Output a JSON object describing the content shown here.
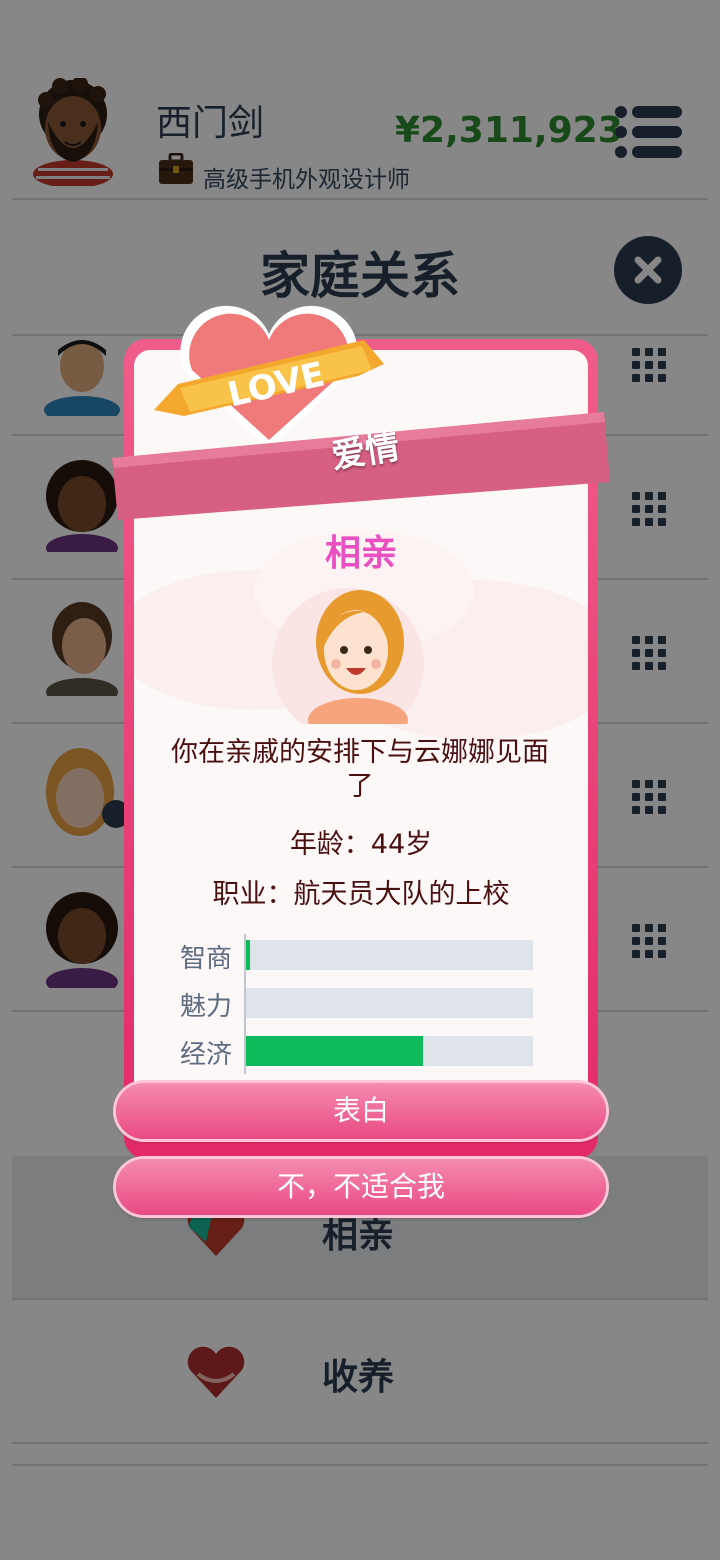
{
  "header": {
    "player_name": "西门剑",
    "job": "高级手机外观设计师",
    "money": "¥2,311,923"
  },
  "page": {
    "title": "家庭关系"
  },
  "options": {
    "date_label": "相亲",
    "adopt_label": "收养"
  },
  "modal": {
    "badge_text": "LOVE",
    "ribbon_text": "爱情",
    "title": "相亲",
    "description": "你在亲戚的安排下与云娜娜见面了",
    "age_text": "年龄：44岁",
    "job_text": "职业：航天员大队的上校",
    "stats": [
      {
        "label": "智商",
        "value": 0.02
      },
      {
        "label": "魅力",
        "value": 0.0
      },
      {
        "label": "经济",
        "value": 0.62
      }
    ],
    "confess_button": "表白",
    "decline_button": "不，不适合我"
  },
  "colors": {
    "money": "#2e8b2e",
    "modal_border": "#e32a67",
    "modal_title": "#e84fc0",
    "stat_fill": "#0fba5a",
    "button": "#e94a83"
  }
}
